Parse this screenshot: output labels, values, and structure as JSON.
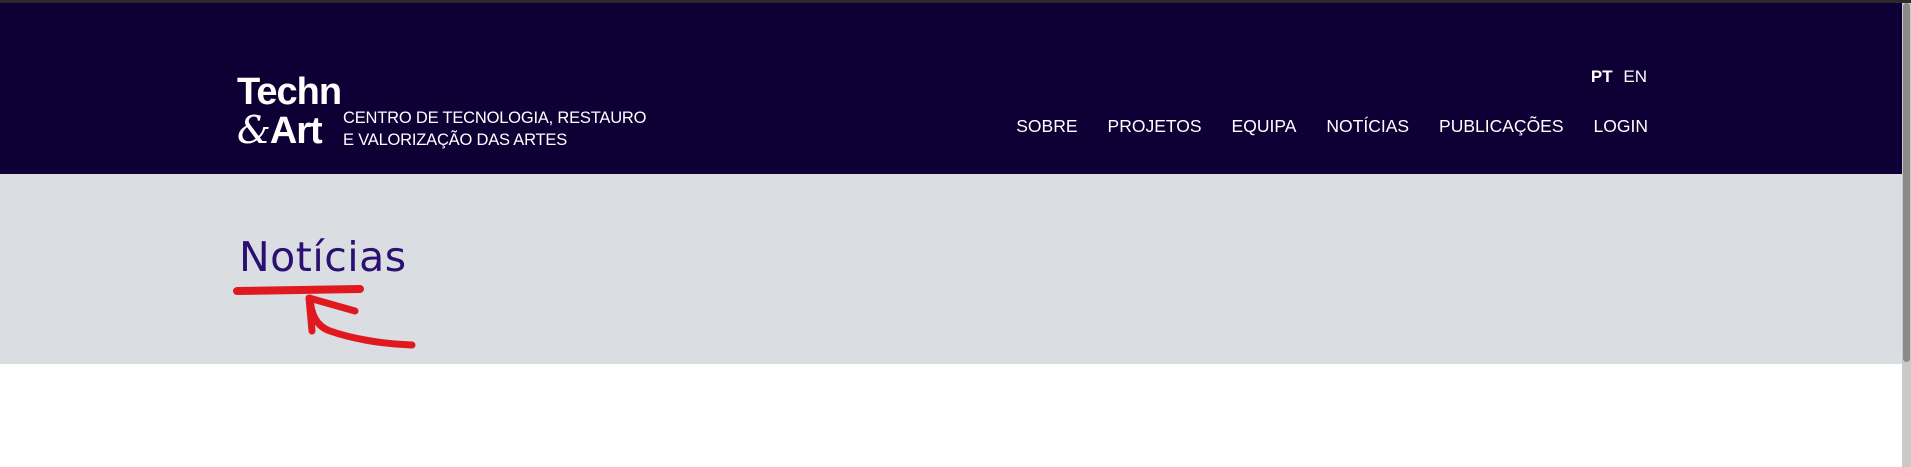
{
  "header": {
    "logo": {
      "line1": "Techn",
      "amp": "&",
      "line2": "Art",
      "desc_line1": "CENTRO DE TECNOLOGIA, RESTAURO",
      "desc_line2": "E VALORIZAÇÃO DAS ARTES"
    },
    "languages": [
      {
        "label": "PT",
        "active": true
      },
      {
        "label": "EN",
        "active": false
      }
    ],
    "nav": [
      "SOBRE",
      "PROJETOS",
      "EQUIPA",
      "NOTÍCIAS",
      "PUBLICAÇÕES",
      "LOGIN"
    ]
  },
  "hero": {
    "title": "Notícias"
  },
  "colors": {
    "header_bg": "#0e0035",
    "hero_bg": "#dadde1",
    "title": "#2a1070",
    "annotation": "#e0191f"
  }
}
